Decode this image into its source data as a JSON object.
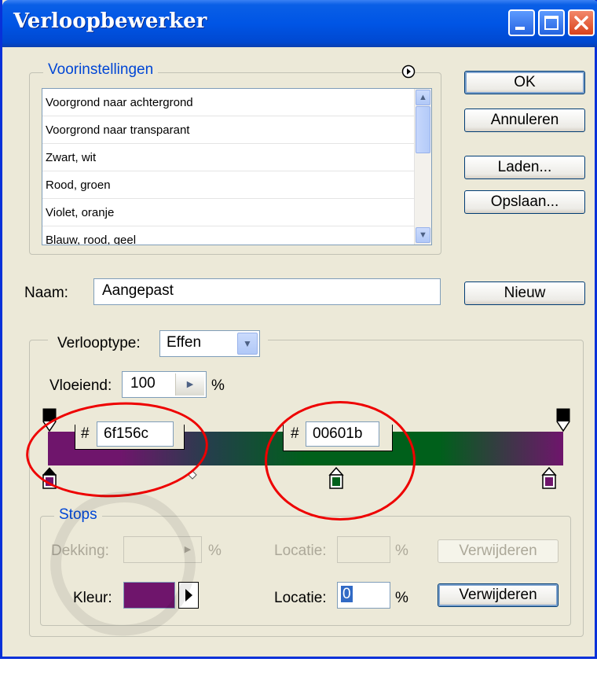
{
  "window": {
    "title": "Verloopbewerker"
  },
  "presets": {
    "label": "Voorinstellingen",
    "items": [
      "Voorgrond naar achtergrond",
      "Voorgrond naar transparant",
      "Zwart, wit",
      "Rood, groen",
      "Violet, oranje",
      "Blauw, rood, geel"
    ],
    "menu_icon": "circle-arrow-icon"
  },
  "buttons": {
    "ok": "OK",
    "cancel": "Annuleren",
    "load": "Laden...",
    "save": "Opslaan...",
    "new": "Nieuw"
  },
  "name": {
    "label": "Naam:",
    "value": "Aangepast"
  },
  "gradient": {
    "type_label": "Verlooptype:",
    "type_value": "Effen",
    "smooth_label": "Vloeiend:",
    "smooth_value": "100",
    "smooth_unit": "%",
    "stop1_hash": "#",
    "stop1_hex": "6f156c",
    "stop2_hash": "#",
    "stop2_hex": "00601b",
    "colors": {
      "left": "#6f156c",
      "mid": "#00601b",
      "right": "#6f156c"
    }
  },
  "stops": {
    "label": "Stops",
    "opacity_label": "Dekking:",
    "opacity_unit": "%",
    "location_label_1": "Locatie:",
    "location_unit_1": "%",
    "delete_1": "Verwijderen",
    "color_label": "Kleur:",
    "color_value": "#6f156c",
    "location_label_2": "Locatie:",
    "location_value_2": "0",
    "location_unit_2": "%",
    "delete_2": "Verwijderen"
  }
}
